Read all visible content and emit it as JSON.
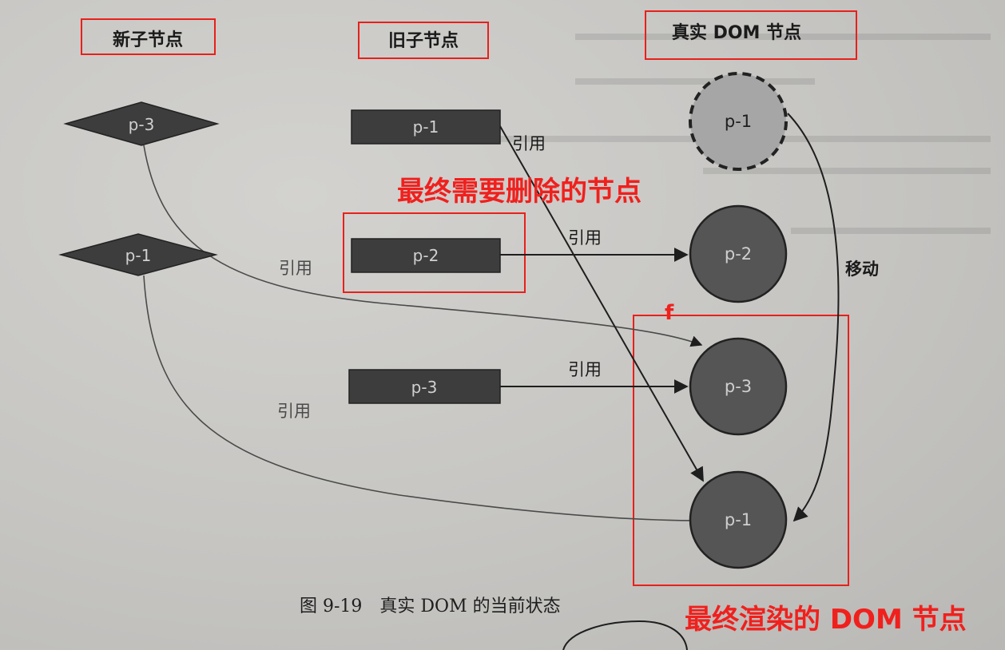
{
  "headers": {
    "new_children": "新子节点",
    "old_children": "旧子节点",
    "real_dom": "真实 DOM 节点"
  },
  "new_children": [
    "p-3",
    "p-1"
  ],
  "old_children": [
    "p-1",
    "p-2",
    "p-3"
  ],
  "real_dom": {
    "removed": "p-1",
    "nodes": [
      "p-2",
      "p-3",
      "p-1"
    ]
  },
  "edge_labels": {
    "reference": "引用",
    "move": "移动"
  },
  "annotations": {
    "to_delete": "最终需要删除的节点",
    "f_mark": "f",
    "rendered": "最终渲染的 DOM 节点"
  },
  "caption": "图 9-19　真实 DOM 的当前状态",
  "colors": {
    "node_dark": "#3d3d3d",
    "node_real": "#555555",
    "node_removed": "#a6a6a6",
    "highlight": "#e8201b",
    "annotation": "#f0201d"
  }
}
